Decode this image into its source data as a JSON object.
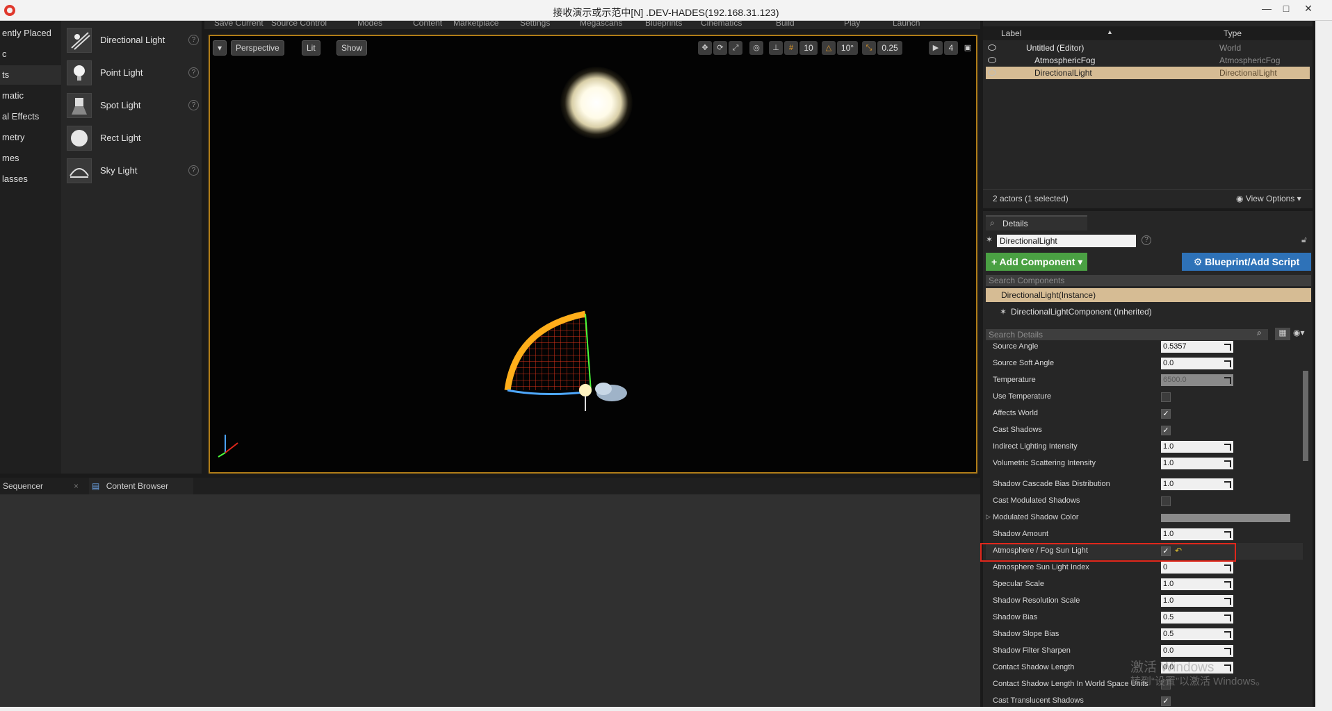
{
  "window": {
    "title": "接收演示或示范中[N] .DEV-HADES(192.168.31.123)"
  },
  "top_menu": [
    "Save Current",
    "Source Control",
    "Modes",
    "Content",
    "Marketplace",
    "Settings",
    "Megascans",
    "Blueprints",
    "Cinematics",
    "Build",
    "Play",
    "Launch"
  ],
  "categories": [
    {
      "label": "ently Placed"
    },
    {
      "label": "c"
    },
    {
      "label": "ts",
      "selected": true
    },
    {
      "label": "matic"
    },
    {
      "label": "al Effects"
    },
    {
      "label": "metry"
    },
    {
      "label": "mes"
    },
    {
      "label": "lasses"
    }
  ],
  "place_items": [
    {
      "label": "Directional Light",
      "icon": "directional-light-icon"
    },
    {
      "label": "Point Light",
      "icon": "point-light-icon"
    },
    {
      "label": "Spot Light",
      "icon": "spot-light-icon"
    },
    {
      "label": "Rect Light",
      "icon": "rect-light-icon"
    },
    {
      "label": "Sky Light",
      "icon": "sky-light-icon"
    }
  ],
  "viewport": {
    "perspective": "Perspective",
    "lit": "Lit",
    "show": "Show",
    "grid_snap": "10",
    "rotation_snap": "10°",
    "scale_snap": "0.25",
    "camera_speed": "4"
  },
  "bottom_tabs": [
    "Sequencer",
    "Content Browser"
  ],
  "outliner": {
    "col_label": "Label",
    "col_type": "Type",
    "rows": [
      {
        "label": "Untitled (Editor)",
        "type": "World",
        "indent": 0
      },
      {
        "label": "AtmosphericFog",
        "type": "AtmosphericFog",
        "indent": 1
      },
      {
        "label": "DirectionalLight",
        "type": "DirectionalLight",
        "indent": 1,
        "selected": true
      }
    ],
    "status": "2 actors (1 selected)",
    "view_options": "View Options"
  },
  "details": {
    "tab": "Details",
    "actor_name": "DirectionalLight",
    "add_component": "Add Component",
    "blueprint": "Blueprint/Add Script",
    "search_components": "Search Components",
    "instance": "DirectionalLight(Instance)",
    "component": "DirectionalLightComponent (Inherited)",
    "search_details": "Search Details",
    "properties": [
      {
        "name": "Source Angle",
        "kind": "number",
        "value": "0.5357"
      },
      {
        "name": "Source Soft Angle",
        "kind": "number",
        "value": "0.0"
      },
      {
        "name": "Temperature",
        "kind": "number",
        "value": "6500.0",
        "disabled": true
      },
      {
        "name": "Use Temperature",
        "kind": "check",
        "checked": false
      },
      {
        "name": "Affects World",
        "kind": "check",
        "checked": true
      },
      {
        "name": "Cast Shadows",
        "kind": "check",
        "checked": true
      },
      {
        "name": "Indirect Lighting Intensity",
        "kind": "number",
        "value": "1.0"
      },
      {
        "name": "Volumetric Scattering Intensity",
        "kind": "number",
        "value": "1.0"
      },
      {
        "name": "Shadow Cascade Bias Distribution",
        "kind": "number",
        "value": "1.0"
      },
      {
        "name": "Cast Modulated Shadows",
        "kind": "check",
        "checked": false
      },
      {
        "name": "Modulated Shadow Color",
        "kind": "color"
      },
      {
        "name": "Shadow Amount",
        "kind": "number",
        "value": "1.0"
      },
      {
        "name": "Atmosphere / Fog Sun Light",
        "kind": "check",
        "checked": true,
        "highlight": true
      },
      {
        "name": "Atmosphere Sun Light Index",
        "kind": "number",
        "value": "0"
      },
      {
        "name": "Specular Scale",
        "kind": "number",
        "value": "1.0"
      },
      {
        "name": "Shadow Resolution Scale",
        "kind": "number",
        "value": "1.0"
      },
      {
        "name": "Shadow Bias",
        "kind": "number",
        "value": "0.5"
      },
      {
        "name": "Shadow Slope Bias",
        "kind": "number",
        "value": "0.5"
      },
      {
        "name": "Shadow Filter Sharpen",
        "kind": "number",
        "value": "0.0"
      },
      {
        "name": "Contact Shadow Length",
        "kind": "number",
        "value": "0.0"
      },
      {
        "name": "Contact Shadow Length In World Space Units",
        "kind": "check",
        "checked": false
      },
      {
        "name": "Cast Translucent Shadows",
        "kind": "check",
        "checked": true
      }
    ]
  },
  "watermark": {
    "line1": "激活 Windows",
    "line2": "转到“设置”以激活 Windows。"
  },
  "colors": {
    "selection": "#d6bc94",
    "viewport_border": "#b07d18",
    "add_button": "#4aa043",
    "blueprint_button": "#2e72b8",
    "highlight_box": "#e0271b"
  }
}
